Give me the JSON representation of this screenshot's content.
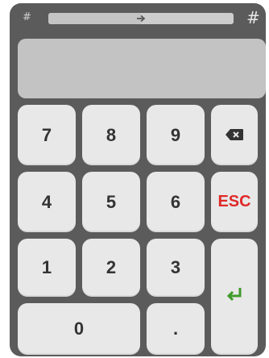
{
  "header": {
    "left_hash": "#",
    "right_hash": "#",
    "progress": 0.5
  },
  "display": {
    "value": ""
  },
  "keys": {
    "k7": "7",
    "k8": "8",
    "k9": "9",
    "k4": "4",
    "k5": "5",
    "k6": "6",
    "k1": "1",
    "k2": "2",
    "k3": "3",
    "k0": "0",
    "dot": ".",
    "esc": "ESC"
  },
  "icons": {
    "arrow": "arrow-right-icon",
    "backspace": "backspace-icon",
    "enter": "enter-icon"
  },
  "colors": {
    "panel": "#5b5b5b",
    "key": "#e8e8e8",
    "display": "#c3c3c3",
    "esc": "#e02a2a",
    "enter": "#3f9a2a"
  }
}
